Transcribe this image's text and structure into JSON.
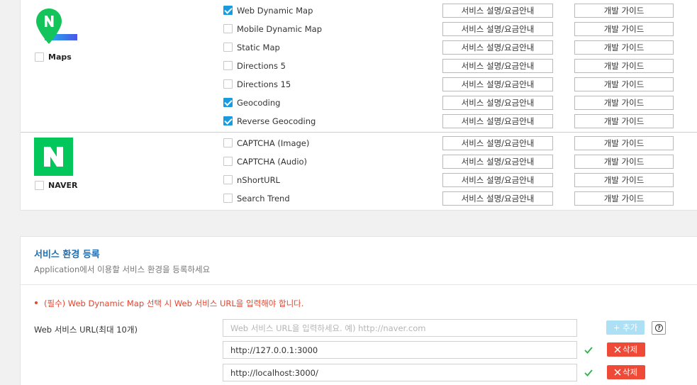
{
  "colors": {
    "accent": "#1d6fb5",
    "check": "#1a9be0",
    "danger": "#ee4a37",
    "required_text": "#e0452f",
    "ok": "#2fb24c",
    "naver_green": "#03c75a"
  },
  "buttons": {
    "service": "서비스 설명/요금안내",
    "guide": "개발 가이드"
  },
  "brands": {
    "maps": {
      "label": "Maps",
      "icon": "map-pin-n-icon",
      "checked": false
    },
    "naver": {
      "label": "NAVER",
      "icon": "naver-n-icon",
      "checked": false
    }
  },
  "apis_maps": [
    {
      "name": "Web Dynamic Map",
      "checked": true
    },
    {
      "name": "Mobile Dynamic Map",
      "checked": false
    },
    {
      "name": "Static Map",
      "checked": false
    },
    {
      "name": "Directions 5",
      "checked": false
    },
    {
      "name": "Directions 15",
      "checked": false
    },
    {
      "name": "Geocoding",
      "checked": true
    },
    {
      "name": "Reverse Geocoding",
      "checked": true
    }
  ],
  "apis_naver": [
    {
      "name": "CAPTCHA (Image)",
      "checked": false
    },
    {
      "name": "CAPTCHA (Audio)",
      "checked": false
    },
    {
      "name": "nShortURL",
      "checked": false
    },
    {
      "name": "Search Trend",
      "checked": false
    }
  ],
  "env": {
    "title": "서비스 환경 등록",
    "description": "Application에서 이용할 서비스 환경을 등록하세요",
    "required_note": "(필수) Web Dynamic Map 선택 시 Web 서비스 URL을 입력해야 합니다.",
    "url_label": "Web 서비스 URL(최대 10개)",
    "url_placeholder": "Web 서비스 URL을 입력하세요. 예) http://naver.com",
    "add_label": "+ 추가",
    "delete_label": "삭제",
    "urls": [
      "http://127.0.0.1:3000",
      "http://localhost:3000/"
    ]
  }
}
